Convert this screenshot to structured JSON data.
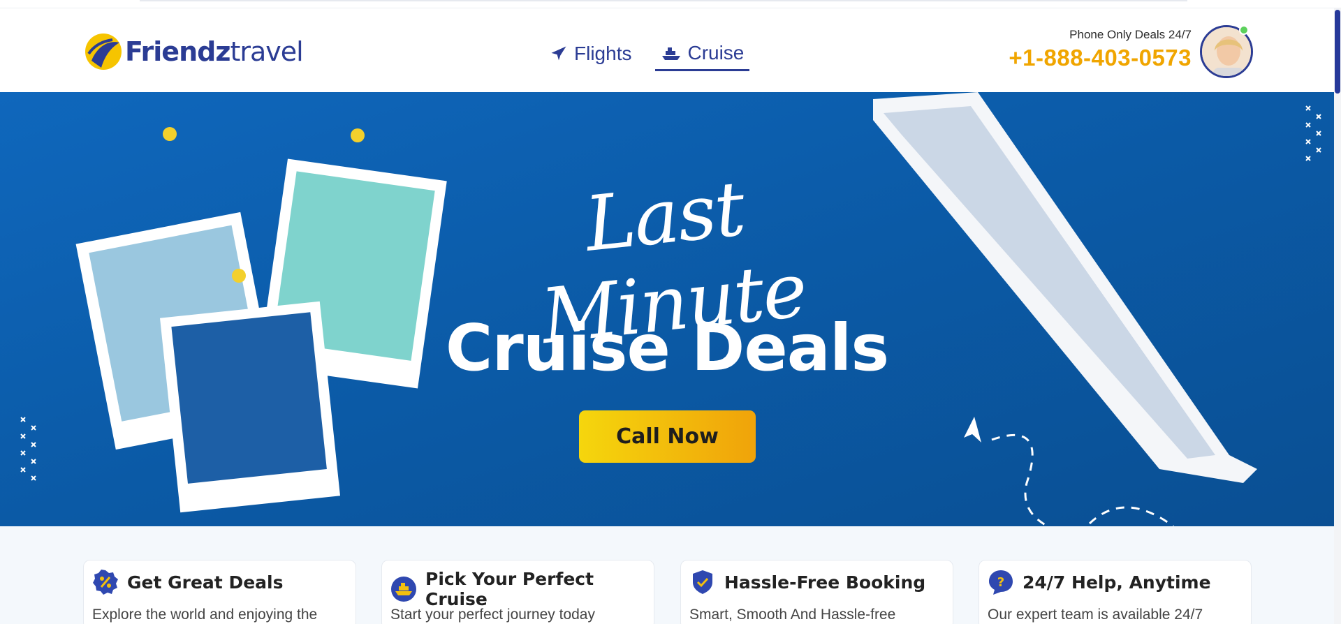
{
  "brand": {
    "name_bold": "Friendz",
    "name_light": "travel",
    "logo_icon": "friendztravel-logo-icon"
  },
  "nav": {
    "items": [
      {
        "label": "Flights",
        "icon": "airplane-icon",
        "active": false
      },
      {
        "label": "Cruise",
        "icon": "cruise-ship-icon",
        "active": true
      }
    ]
  },
  "contact": {
    "label": "Phone Only Deals 24/7",
    "phone": "+1-888-403-0573",
    "agent_icon": "support-agent-avatar"
  },
  "hero": {
    "script_title": "Last Minute",
    "title": "Cruise Deals",
    "cta_label": "Call Now"
  },
  "features": [
    {
      "title": "Get Great Deals",
      "text": "Explore the world and enjoying the",
      "icon": "discount-badge-icon"
    },
    {
      "title": "Pick Your Perfect Cruise",
      "text": "Start your perfect journey today",
      "icon": "ship-circle-icon"
    },
    {
      "title": "Hassle-Free Booking",
      "text": "Smart, Smooth And Hassle-free",
      "icon": "shield-check-icon"
    },
    {
      "title": "24/7 Help, Anytime",
      "text": "Our expert team is available 24/7",
      "icon": "help-bubble-icon"
    }
  ],
  "colors": {
    "brand_blue": "#2b3c94",
    "phone_gold": "#f0a500",
    "cta_gradient_start": "#f5d60d",
    "cta_gradient_end": "#f0a30a",
    "hero_sea": "#0d5fb0"
  }
}
